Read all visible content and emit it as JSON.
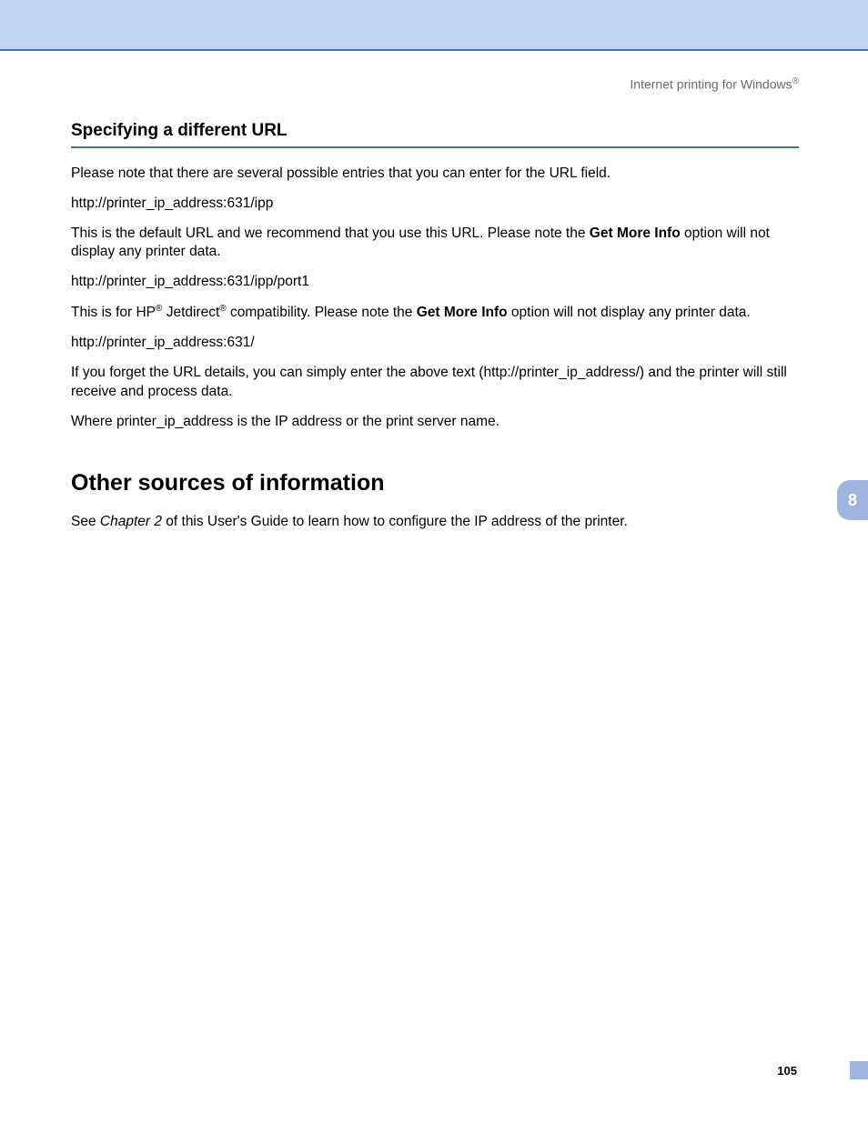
{
  "header": {
    "text_a": "Internet printing for Windows",
    "reg": "®"
  },
  "section": {
    "title": "Specifying a different URL",
    "p1": "Please note that there are several possible entries that you can enter for the URL field.",
    "p2": "http://printer_ip_address:631/ipp",
    "p3_a": "This is the default URL and we recommend that you use this URL. Please note the ",
    "p3_b": "Get More Info",
    "p3_c": " option will not display any printer data.",
    "p4": "http://printer_ip_address:631/ipp/port1",
    "p5_a": "This is for HP",
    "p5_reg1": "®",
    "p5_b": " Jetdirect",
    "p5_reg2": "®",
    "p5_c": " compatibility. Please note the ",
    "p5_d": "Get More Info",
    "p5_e": " option will not display any printer data.",
    "p6": "http://printer_ip_address:631/",
    "p7": "If you forget the URL details, you can simply enter the above text (http://printer_ip_address/) and the printer will still receive and process data.",
    "p8": "Where printer_ip_address is the IP address or the print server name."
  },
  "main_heading": "Other sources of information",
  "main_para_a": "See ",
  "main_para_b": "Chapter 2",
  "main_para_c": " of this User's Guide to learn how to configure the IP address of the printer.",
  "side_tab": "8",
  "page_number": "105"
}
